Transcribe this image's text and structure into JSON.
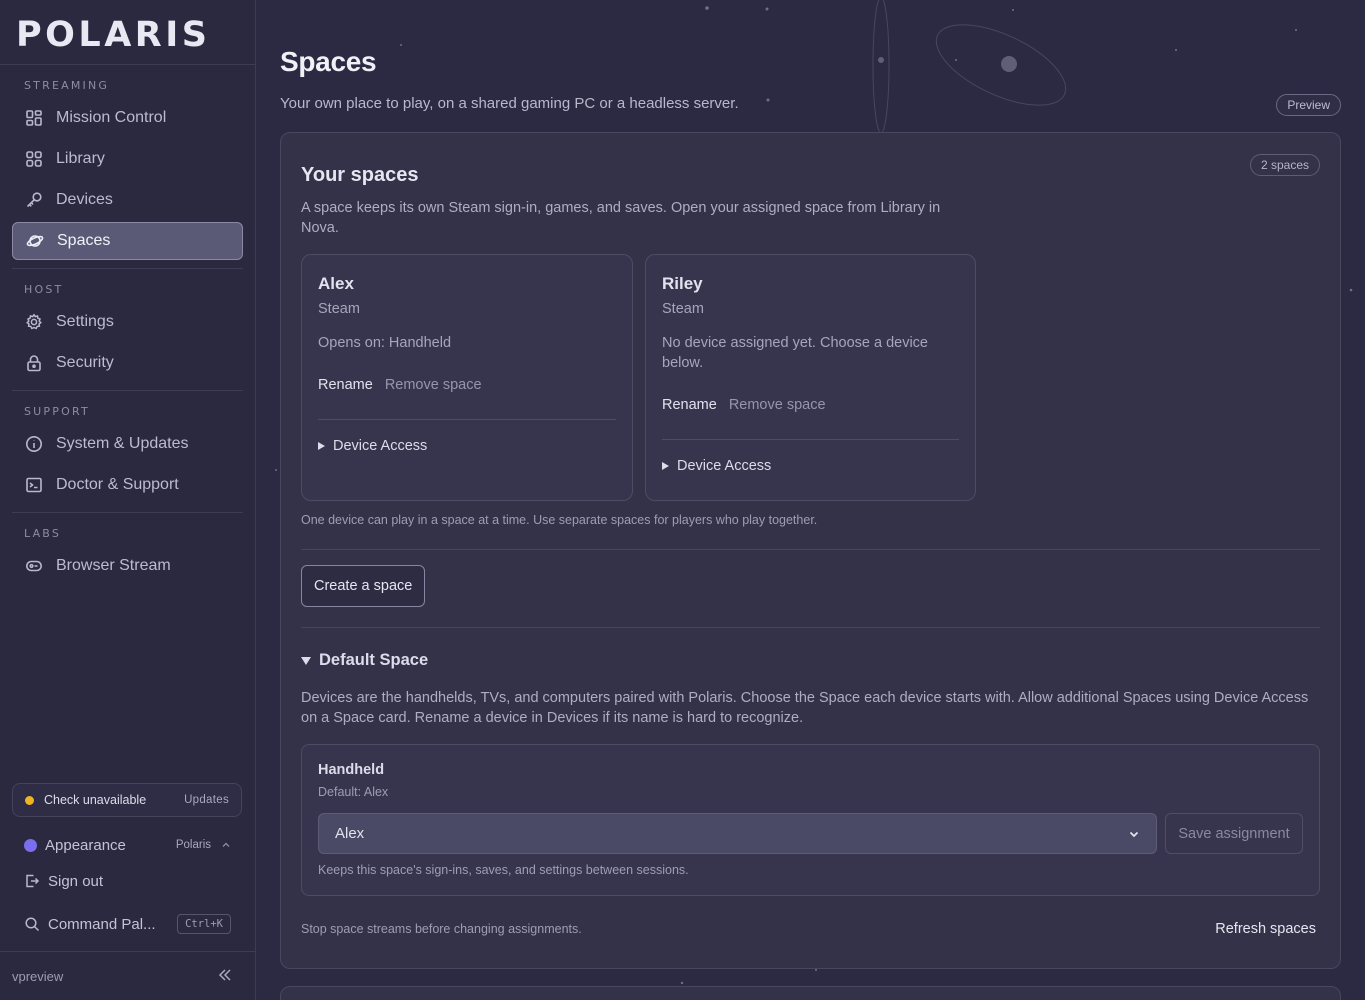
{
  "brand": {
    "name": "POLARIS"
  },
  "sidebar": {
    "sections": [
      {
        "heading": "STREAMING",
        "items": [
          {
            "label": "Mission Control",
            "icon": "dashboard-icon"
          },
          {
            "label": "Library",
            "icon": "grid-icon"
          },
          {
            "label": "Devices",
            "icon": "key-icon"
          },
          {
            "label": "Spaces",
            "icon": "planet-icon",
            "active": true
          }
        ]
      },
      {
        "heading": "HOST",
        "items": [
          {
            "label": "Settings",
            "icon": "gear-icon"
          },
          {
            "label": "Security",
            "icon": "lock-icon"
          }
        ]
      },
      {
        "heading": "SUPPORT",
        "items": [
          {
            "label": "System & Updates",
            "icon": "info-icon"
          },
          {
            "label": "Doctor & Support",
            "icon": "terminal-icon"
          }
        ]
      },
      {
        "heading": "LABS",
        "items": [
          {
            "label": "Browser Stream",
            "icon": "stream-icon"
          }
        ]
      }
    ],
    "check": {
      "label": "Check unavailable",
      "action": "Updates",
      "color": "#f0b323"
    },
    "appearance": {
      "label": "Appearance",
      "theme": "Polaris",
      "color": "#7b6df0"
    },
    "sign_out": "Sign out",
    "command_palette": {
      "label": "Command Pal...",
      "shortcut": "Ctrl+K"
    },
    "version": "vpreview"
  },
  "page": {
    "title": "Spaces",
    "subtitle": "Your own place to play, on a shared gaming PC or a headless server.",
    "badge": "Preview"
  },
  "spaces_card": {
    "title": "Your spaces",
    "count": "2 spaces",
    "description": "A space keeps its own Steam sign-in, games, and saves. Open your assigned space from Library in Nova.",
    "spaces": [
      {
        "name": "Alex",
        "provider": "Steam",
        "status": "Opens on: Handheld",
        "rename": "Rename",
        "remove": "Remove space",
        "device_access": "Device Access"
      },
      {
        "name": "Riley",
        "provider": "Steam",
        "status": "No device assigned yet. Choose a device below.",
        "rename": "Rename",
        "remove": "Remove space",
        "device_access": "Device Access"
      }
    ],
    "note": "One device can play in a space at a time. Use separate spaces for players who play together.",
    "create_button": "Create a space",
    "default_space": {
      "heading": "Default Space",
      "description": "Devices are the handhelds, TVs, and computers paired with Polaris. Choose the Space each device starts with. Allow additional Spaces using Device Access on a Space card. Rename a device in Devices if its name is hard to recognize.",
      "device": {
        "name": "Handheld",
        "default_label": "Default: Alex",
        "selected": "Alex",
        "save_button": "Save assignment",
        "help": "Keeps this space's sign-ins, saves, and settings between sessions."
      }
    },
    "stop_note": "Stop space streams before changing assignments.",
    "refresh": "Refresh spaces"
  }
}
